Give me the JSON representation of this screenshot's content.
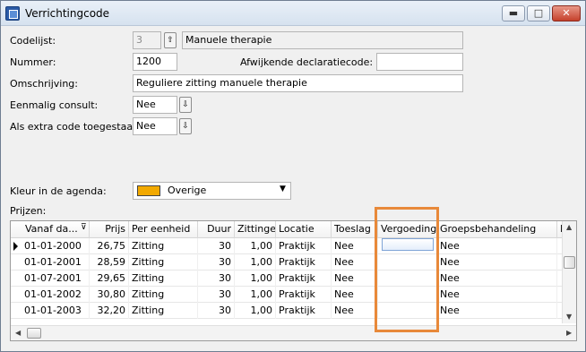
{
  "window": {
    "title": "Verrichtingcode",
    "buttons": {
      "minimize": "▬",
      "maximize": "□",
      "close": "✕"
    }
  },
  "form": {
    "codelijst": {
      "label": "Codelijst:",
      "value": "3",
      "description": "Manuele therapie"
    },
    "nummer": {
      "label": "Nummer:",
      "value": "1200"
    },
    "afwijkende": {
      "label": "Afwijkende declaratiecode:",
      "value": ""
    },
    "omschrijving": {
      "label": "Omschrijving:",
      "value": "Reguliere zitting manuele therapie"
    },
    "eenmalig": {
      "label": "Eenmalig consult:",
      "value": "Nee"
    },
    "extra_code": {
      "label": "Als extra code toegestaan:",
      "value": "Nee"
    },
    "kleur": {
      "label": "Kleur in de agenda:",
      "value": "Overige",
      "swatch": "#f2a900"
    },
    "prijzen_label": "Prijzen:"
  },
  "grid": {
    "columns": [
      "Vanaf da...",
      "Prijs",
      "Per eenheid",
      "Duur",
      "Zittingen",
      "Locatie",
      "Toeslag",
      "Vergoeding",
      "Groepsbehandeling",
      "I"
    ],
    "rows": [
      [
        "01-01-2000",
        "26,75",
        "Zitting",
        "30",
        "1,00",
        "Praktijk",
        "Nee",
        "",
        "Nee"
      ],
      [
        "01-01-2001",
        "28,59",
        "Zitting",
        "30",
        "1,00",
        "Praktijk",
        "Nee",
        "",
        "Nee"
      ],
      [
        "01-07-2001",
        "29,65",
        "Zitting",
        "30",
        "1,00",
        "Praktijk",
        "Nee",
        "",
        "Nee"
      ],
      [
        "01-01-2002",
        "30,80",
        "Zitting",
        "30",
        "1,00",
        "Praktijk",
        "Nee",
        "",
        "Nee"
      ],
      [
        "01-01-2003",
        "32,20",
        "Zitting",
        "30",
        "1,00",
        "Praktijk",
        "Nee",
        "",
        "Nee"
      ]
    ]
  },
  "colors": {
    "highlight": "#e8893a"
  }
}
